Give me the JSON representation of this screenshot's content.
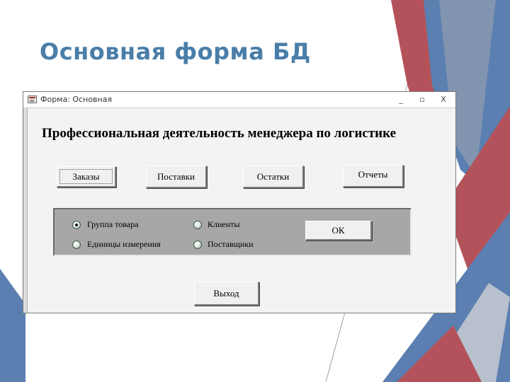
{
  "slide": {
    "title": "Основная форма БД"
  },
  "window": {
    "title": "Форма: Основная",
    "controls": {
      "minimize": "_",
      "maximize": "▫",
      "close": "X"
    }
  },
  "form": {
    "heading": "Профессиональная деятельность менеджера по логистике",
    "buttons": {
      "orders": "Заказы",
      "deliveries": "Поставки",
      "stock": "Остатки",
      "reports": "Отчеты"
    },
    "options": [
      {
        "label": "Группа товара",
        "selected": true
      },
      {
        "label": "Клиенты",
        "selected": false
      },
      {
        "label": "Единицы измерения",
        "selected": false
      },
      {
        "label": "Поставщики",
        "selected": false
      }
    ],
    "ok_label": "ОК",
    "exit_label": "Выход"
  },
  "colors": {
    "title": "#4a7ea8",
    "panel": "#a7a7a7",
    "deco_red": "#b3525a",
    "deco_blue": "#5a7fb0",
    "deco_gray": "#8f9bb0"
  }
}
